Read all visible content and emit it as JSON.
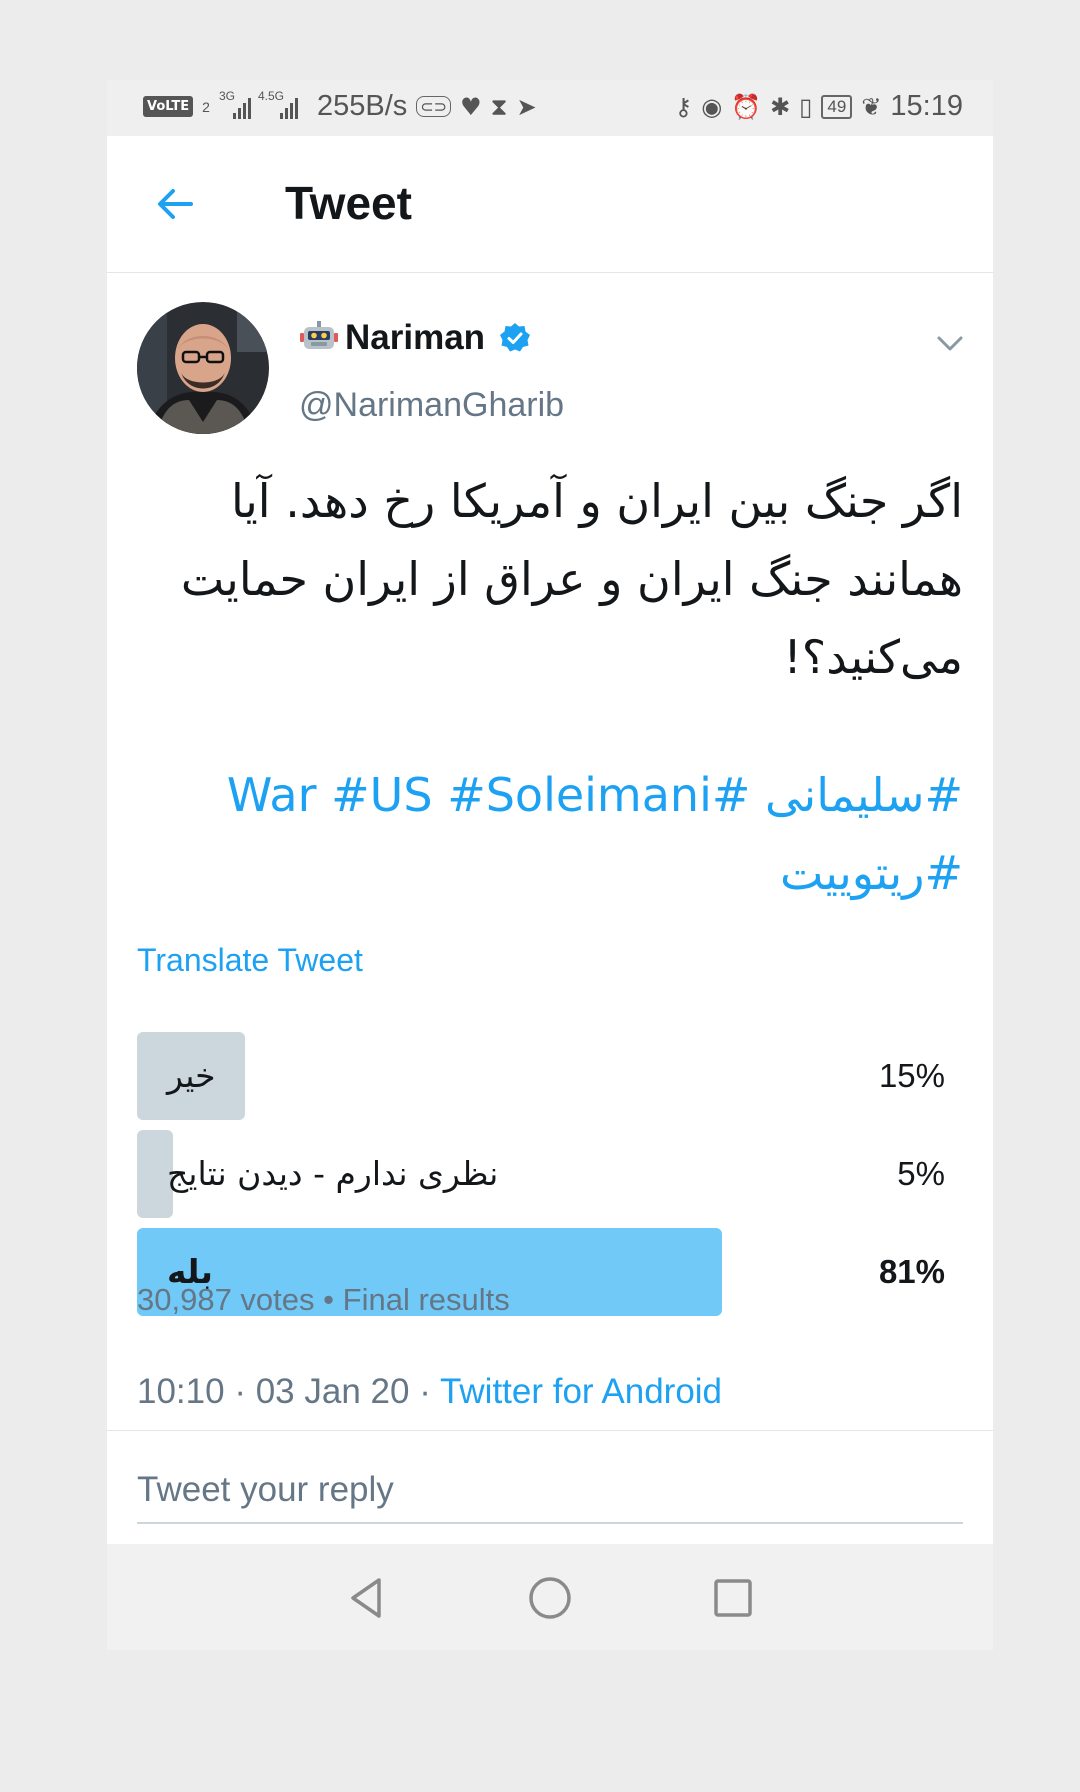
{
  "status_bar": {
    "volte": "VoLTE",
    "sim": "2",
    "net1": "3G",
    "net2": "4.5G",
    "speed": "255B/s",
    "battery": "49",
    "time": "15:19"
  },
  "header": {
    "title": "Tweet",
    "back_icon": "arrow-left-icon"
  },
  "tweet": {
    "author_emoji_icon": "robot-icon",
    "author_name": "Nariman",
    "verified_icon": "verified-badge-icon",
    "handle": "@NarimanGharib",
    "text_line1": "اگر جنگ بین ایران و آمریکا رخ دهد. آیا",
    "text_line2": "همانند جنگ ایران و عراق از ایران حمایت",
    "text_line3": "می‌کنید؟!",
    "hashtag_1": "#سلیمانی",
    "hashtag_2": "#War",
    "hashtag_3": "#US",
    "hashtag_4": "#Soleimani",
    "hashtag_5": "#ریتوییت",
    "translate_label": "Translate Tweet"
  },
  "poll": {
    "options": [
      {
        "label": "خیر",
        "percent_text": "15%",
        "fraction": 0.15,
        "winner": false
      },
      {
        "label": "نظری ندارم - دیدن نتایج",
        "percent_text": "5%",
        "fraction": 0.05,
        "winner": false
      },
      {
        "label": "بله",
        "percent_text": "81%",
        "fraction": 0.81,
        "winner": true
      }
    ],
    "votes": "30,987 votes",
    "separator": "•",
    "status": "Final results"
  },
  "meta": {
    "time": "10:10",
    "dot1": "·",
    "date": "03 Jan 20",
    "dot2": "·",
    "source": "Twitter for Android"
  },
  "reply": {
    "placeholder": "Tweet your reply"
  },
  "colors": {
    "accent": "#1da1f2",
    "poll_winner": "#71c9f8",
    "poll_other": "#ccd6dd"
  }
}
